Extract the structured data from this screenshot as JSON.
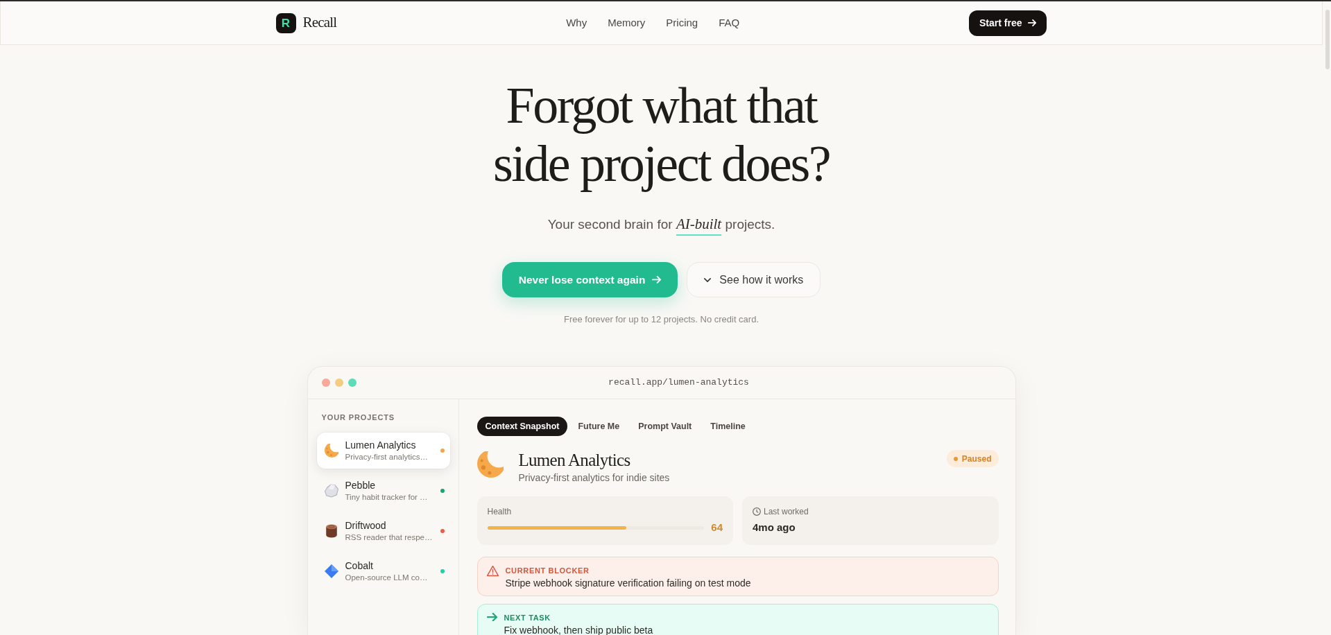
{
  "nav": {
    "logo_mark": "R",
    "brand": "Recall",
    "links": [
      "Why",
      "Memory",
      "Pricing",
      "FAQ"
    ],
    "cta": "Start free"
  },
  "hero": {
    "title": "Forgot what that side project does?",
    "subtitle": "Your second brain for *AI-built* projects.",
    "primary_button": "Never lose context again",
    "secondary_button": "See how it works",
    "note": "Free forever for up to 12 projects. No credit card."
  },
  "app_window": {
    "url": "recall.app/lumen-analytics",
    "sidebar": {
      "heading": "YOUR PROJECTS",
      "projects": [
        {
          "name": "Lumen Analytics",
          "description": "Privacy-first analytics…",
          "color": "#f2a64a",
          "selected": true
        },
        {
          "name": "Pebble",
          "description": "Tiny habit tracker for …",
          "color": "#14a673",
          "selected": false
        },
        {
          "name": "Driftwood",
          "description": "RSS reader that respe…",
          "color": "#ef5b46",
          "selected": false
        },
        {
          "name": "Cobalt",
          "description": "Open-source LLM co…",
          "color": "#1fd19e",
          "selected": false
        }
      ]
    },
    "tabs": [
      {
        "label": "Context Snapshot",
        "selected": true
      },
      {
        "label": "Future Me",
        "selected": false
      },
      {
        "label": "Prompt Vault",
        "selected": false
      },
      {
        "label": "Timeline",
        "selected": false
      }
    ],
    "project": {
      "name": "Lumen Analytics",
      "description": "Privacy-first analytics for indie sites",
      "status": "Paused"
    },
    "health": {
      "label": "Health",
      "level": 0.64,
      "value": "64"
    },
    "last_worked": {
      "label": "Last worked",
      "value": "4mo ago"
    },
    "notices": [
      {
        "kind": "blocker",
        "title": "CURRENT BLOCKER",
        "text": "Stripe webhook signature verification failing on test mode"
      },
      {
        "kind": "next",
        "title": "NEXT TASK",
        "text": "Fix webhook, then ship public beta"
      }
    ]
  }
}
